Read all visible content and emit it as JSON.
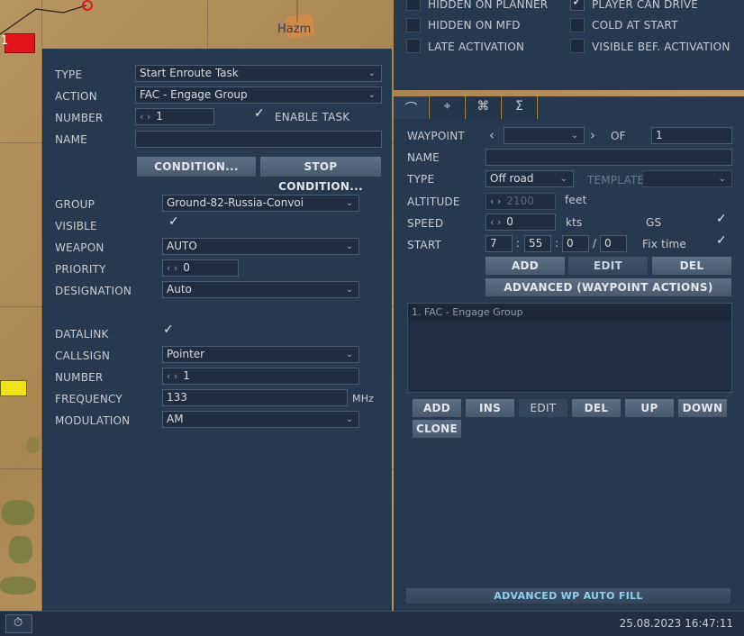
{
  "map": {
    "town_label": "Hazm",
    "unit_label": "1"
  },
  "task_panel": {
    "type_label": "TYPE",
    "type_value": "Start Enroute Task",
    "action_label": "ACTION",
    "action_value": "FAC - Engage Group",
    "number_label": "NUMBER",
    "number_value": "1",
    "enable_task_label": "ENABLE TASK",
    "enable_task_checked": true,
    "name_label": "NAME",
    "name_value": "",
    "condition_button": "CONDITION...",
    "stop_condition_button": "STOP CONDITION...",
    "group_label": "GROUP",
    "group_value": "Ground-82-Russia-Convoi",
    "visible_label": "VISIBLE",
    "visible_checked": true,
    "weapon_label": "WEAPON",
    "weapon_value": "AUTO",
    "priority_label": "PRIORITY",
    "priority_value": "0",
    "designation_label": "DESIGNATION",
    "designation_value": "Auto",
    "datalink_label": "DATALINK",
    "datalink_checked": true,
    "callsign_label": "CALLSIGN",
    "callsign_value": "Pointer",
    "callsign_number_label": "NUMBER",
    "callsign_number_value": "1",
    "frequency_label": "FREQUENCY",
    "frequency_value": "133",
    "frequency_unit": "MHz",
    "modulation_label": "MODULATION",
    "modulation_value": "AM"
  },
  "unit_options": {
    "hidden_on_planner": "HIDDEN ON PLANNER",
    "hidden_on_planner_checked": false,
    "player_can_drive": "PLAYER CAN DRIVE",
    "player_can_drive_checked": true,
    "hidden_on_mfd": "HIDDEN ON MFD",
    "hidden_on_mfd_checked": false,
    "cold_at_start": "COLD AT START",
    "cold_at_start_checked": false,
    "late_activation": "LATE ACTIVATION",
    "late_activation_checked": false,
    "visible_bef_activation": "VISIBLE BEF. ACTIVATION",
    "visible_bef_activation_checked": false
  },
  "tabs": [
    "route-icon",
    "target-icon",
    "payload-icon",
    "summary-icon"
  ],
  "waypoint_panel": {
    "waypoint_label": "WAYPOINT",
    "of_label": "OF",
    "of_value": "1",
    "name_label": "NAME",
    "name_value": "",
    "type_label": "TYPE",
    "type_value": "Off road",
    "template_label": "TEMPLATE",
    "template_value": "",
    "altitude_label": "ALTITUDE",
    "altitude_value": "2100",
    "altitude_unit": "feet",
    "speed_label": "SPEED",
    "speed_value": "0",
    "speed_unit": "kts",
    "gs_label": "GS",
    "gs_checked": true,
    "start_label": "START",
    "start_day": "7",
    "start_hour": "55",
    "start_min": "0",
    "start_sec": "0",
    "fix_time_label": "Fix time",
    "fix_time_checked": true,
    "add_button": "ADD",
    "edit_button": "EDIT",
    "del_button": "DEL",
    "advanced_button": "ADVANCED (WAYPOINT ACTIONS)",
    "actions": [
      "1. FAC - Engage Group"
    ],
    "list_buttons": {
      "add": "ADD",
      "ins": "INS",
      "edit": "EDIT",
      "del": "DEL",
      "up": "UP",
      "down": "DOWN",
      "clone": "CLONE"
    },
    "auto_fill_button": "ADVANCED WP AUTO FILL"
  },
  "status_bar": {
    "datetime": "25.08.2023 16:47:11"
  }
}
